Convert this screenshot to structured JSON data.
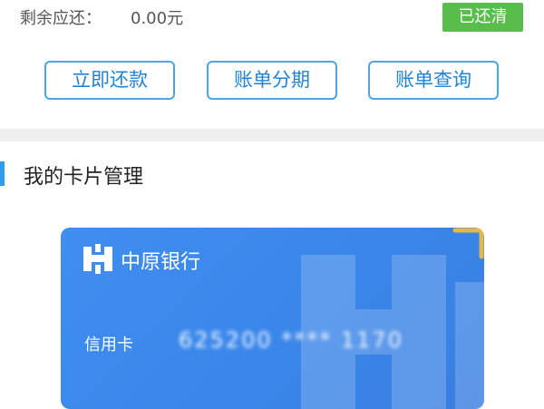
{
  "summary": {
    "remaining_label": "剩余应还：",
    "remaining_value": "0.00元",
    "status_badge": "已还清"
  },
  "actions": {
    "repay_label": "立即还款",
    "installment_label": "账单分期",
    "query_label": "账单查询"
  },
  "cards_section": {
    "title": "我的卡片管理"
  },
  "card": {
    "bank_name": "中原银行",
    "card_type": "信用卡",
    "card_number_masked": "625200 **** 1170"
  },
  "colors": {
    "accent": "#1f84d6",
    "badge_green": "#58bd4a",
    "card_blue": "#3a86ea",
    "card_corner_gold": "#e6b84a"
  },
  "icons": {
    "bank_logo": "zhongyuan-bank-logo-icon",
    "card_watermark": "bank-watermark-icon"
  }
}
